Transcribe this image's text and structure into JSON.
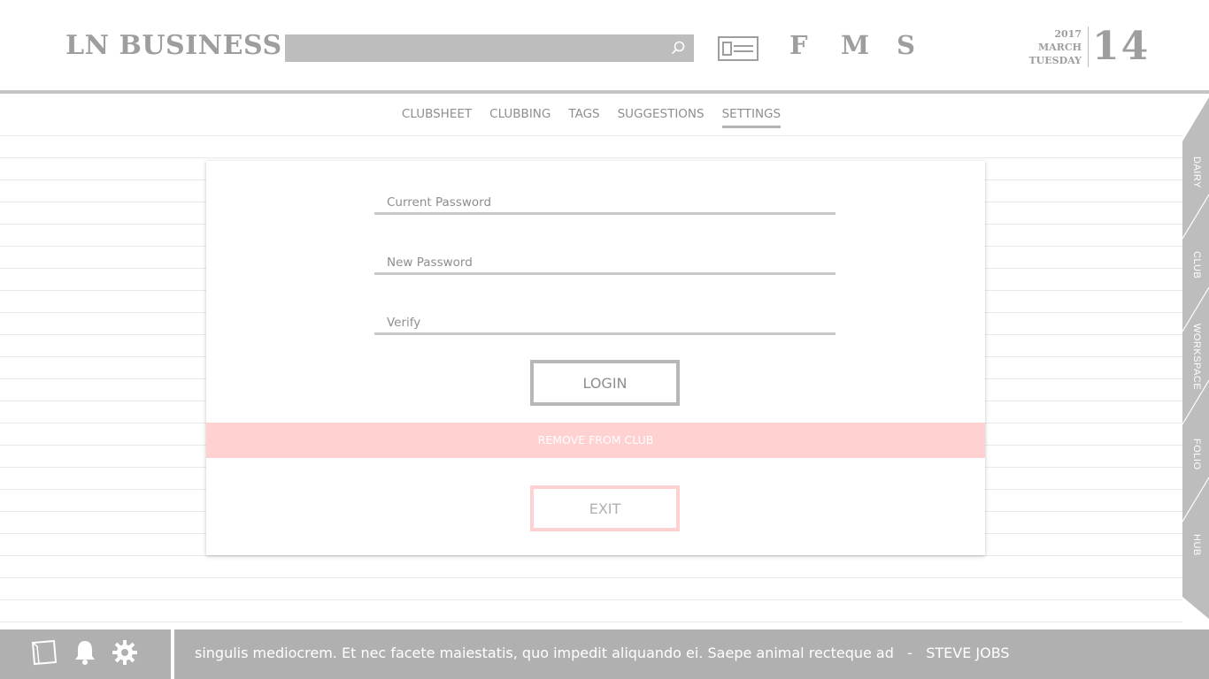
{
  "header": {
    "logo": "LN BUSINESS",
    "search_placeholder": "",
    "icons": [
      "search-icon",
      "id-card-icon"
    ],
    "letters": [
      "F",
      "M",
      "S"
    ],
    "date": {
      "year": "2017",
      "month": "MARCH",
      "weekday": "TUESDAY",
      "day": "14"
    }
  },
  "tabs": [
    {
      "label": "CLUBSHEET",
      "active": false
    },
    {
      "label": "CLUBBING",
      "active": false
    },
    {
      "label": "TAGS",
      "active": false
    },
    {
      "label": "SUGGESTIONS",
      "active": false
    },
    {
      "label": "SETTINGS",
      "active": true
    }
  ],
  "side_tabs": [
    "DAIRY",
    "CLUB",
    "WORKSPACE",
    "FOLIO",
    "HUB"
  ],
  "settings_form": {
    "current_password_placeholder": "Current Password",
    "new_password_placeholder": "New Password",
    "verify_placeholder": "Verify",
    "login_label": "LOGIN",
    "remove_label": "REMOVE FROM CLUB",
    "exit_label": "EXIT"
  },
  "footer": {
    "icons": [
      "notes-icon",
      "bell-icon",
      "gear-icon"
    ],
    "quote": "singulis mediocrem. Et nec facete maiestatis, quo impedit aliquando ei. Saepe animal recteque ad",
    "separator": "-",
    "author": "STEVE JOBS"
  },
  "colors": {
    "accent_pink": "#ffd1d1",
    "gray": "#b0b0b0",
    "text": "#8e8e8e"
  }
}
